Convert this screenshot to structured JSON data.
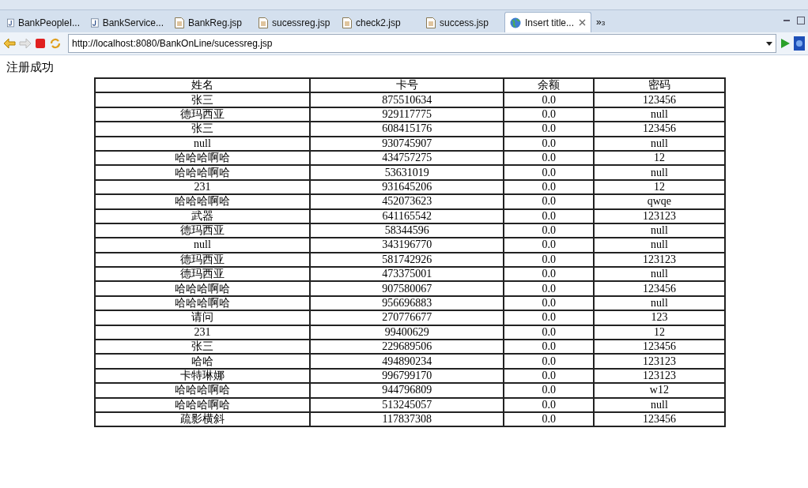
{
  "tabs": [
    {
      "label": "BankPeopleI...",
      "kind": "java",
      "selected": false
    },
    {
      "label": "BankService...",
      "kind": "java",
      "selected": false
    },
    {
      "label": "BankReg.jsp",
      "kind": "jsp",
      "selected": false
    },
    {
      "label": "sucessreg.jsp",
      "kind": "jsp",
      "selected": false
    },
    {
      "label": "check2.jsp",
      "kind": "jsp",
      "selected": false
    },
    {
      "label": "success.jsp",
      "kind": "jsp",
      "selected": false
    },
    {
      "label": "Insert title...",
      "kind": "web",
      "selected": true
    }
  ],
  "overflow": {
    "symbol": "»",
    "count": "3"
  },
  "address": {
    "url": "http://localhost:8080/BankOnLine/sucessreg.jsp"
  },
  "page": {
    "heading": "注册成功",
    "table": {
      "columns": [
        "姓名",
        "卡号",
        "余额",
        "密码"
      ],
      "rows": [
        [
          "张三",
          "875510634",
          "0.0",
          "123456"
        ],
        [
          "德玛西亚",
          "929117775",
          "0.0",
          "null"
        ],
        [
          "张三",
          "608415176",
          "0.0",
          "123456"
        ],
        [
          "null",
          "930745907",
          "0.0",
          "null"
        ],
        [
          "哈哈哈啊哈",
          "434757275",
          "0.0",
          "12"
        ],
        [
          "哈哈哈啊哈",
          "53631019",
          "0.0",
          "null"
        ],
        [
          "231",
          "931645206",
          "0.0",
          "12"
        ],
        [
          "哈哈哈啊哈",
          "452073623",
          "0.0",
          "qwqe"
        ],
        [
          "武器",
          "641165542",
          "0.0",
          "123123"
        ],
        [
          "德玛西亚",
          "58344596",
          "0.0",
          "null"
        ],
        [
          "null",
          "343196770",
          "0.0",
          "null"
        ],
        [
          "德玛西亚",
          "581742926",
          "0.0",
          "123123"
        ],
        [
          "德玛西亚",
          "473375001",
          "0.0",
          "null"
        ],
        [
          "哈哈哈啊哈",
          "907580067",
          "0.0",
          "123456"
        ],
        [
          "哈哈哈啊哈",
          "956696883",
          "0.0",
          "null"
        ],
        [
          "请问",
          "270776677",
          "0.0",
          "123"
        ],
        [
          "231",
          "99400629",
          "0.0",
          "12"
        ],
        [
          "张三",
          "229689506",
          "0.0",
          "123456"
        ],
        [
          "哈哈",
          "494890234",
          "0.0",
          "123123"
        ],
        [
          "卡特琳娜",
          "996799170",
          "0.0",
          "123123"
        ],
        [
          "哈哈哈啊哈",
          "944796809",
          "0.0",
          "w12"
        ],
        [
          "哈哈哈啊哈",
          "513245057",
          "0.0",
          "null"
        ],
        [
          "疏影横斜",
          "117837308",
          "0.0",
          "123456"
        ]
      ]
    }
  }
}
